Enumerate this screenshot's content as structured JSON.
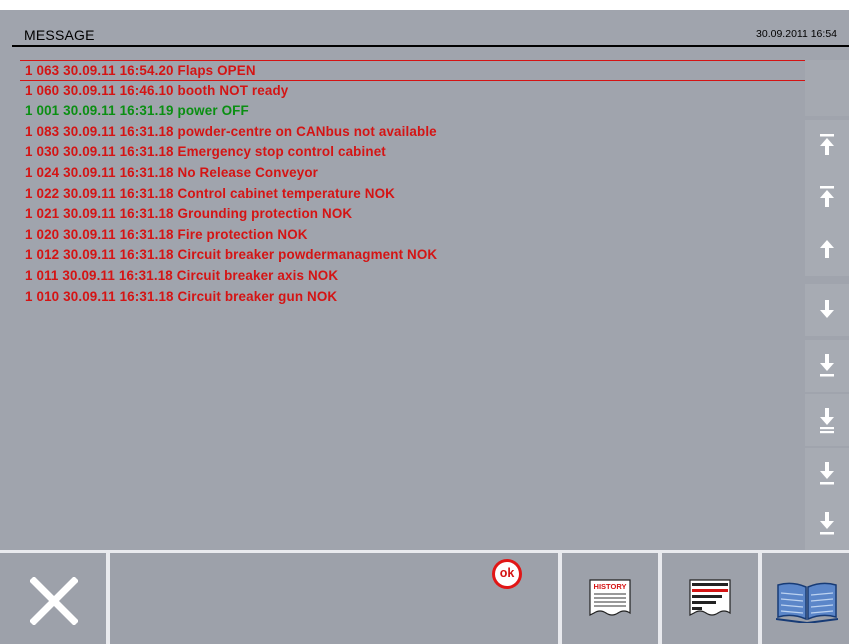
{
  "header": {
    "title": "MESSAGE",
    "datetime": "30.09.2011 16:54"
  },
  "messages": [
    {
      "text": "1  063  30.09.11  16:54.20 Flaps OPEN",
      "color": "red",
      "selected": true
    },
    {
      "text": "1  060  30.09.11  16:46.10 booth NOT ready",
      "color": "red",
      "selected": false
    },
    {
      "text": "1  001  30.09.11  16:31.19 power OFF",
      "color": "green",
      "selected": false
    },
    {
      "text": "1  083  30.09.11  16:31.18 powder-centre on CANbus not available",
      "color": "red",
      "selected": false
    },
    {
      "text": "1  030  30.09.11  16:31.18 Emergency stop control cabinet",
      "color": "red",
      "selected": false
    },
    {
      "text": "1  024  30.09.11  16:31.18 No Release Conveyor",
      "color": "red",
      "selected": false
    },
    {
      "text": "1  022  30.09.11  16:31.18 Control cabinet temperature NOK",
      "color": "red",
      "selected": false
    },
    {
      "text": "1  021  30.09.11  16:31.18 Grounding protection NOK",
      "color": "red",
      "selected": false
    },
    {
      "text": "1  020  30.09.11  16:31.18 Fire protection NOK",
      "color": "red",
      "selected": false
    },
    {
      "text": "1  012  30.09.11  16:31.18 Circuit breaker powdermanagment NOK",
      "color": "red",
      "selected": false
    },
    {
      "text": "1  011  30.09.11  16:31.18 Circuit breaker axis NOK",
      "color": "red",
      "selected": false
    },
    {
      "text": "1  010  30.09.11  16:31.18 Circuit breaker gun NOK",
      "color": "red",
      "selected": false
    }
  ],
  "scroll_buttons": [
    {
      "name": "scroll-top-button",
      "icon": "arrow-up-to-top-icon"
    },
    {
      "name": "page-up-button",
      "icon": "arrow-up-to-line-icon"
    },
    {
      "name": "line-up-button",
      "icon": "arrow-up-icon"
    },
    {
      "name": "line-down-button",
      "icon": "arrow-down-icon"
    },
    {
      "name": "page-down-button",
      "icon": "arrow-down-to-line-icon"
    },
    {
      "name": "scroll-down-2-button",
      "icon": "arrow-down-to-double-line-icon"
    },
    {
      "name": "scroll-down-3-button",
      "icon": "arrow-down-to-line-icon"
    },
    {
      "name": "scroll-bottom-button",
      "icon": "arrow-down-to-bottom-icon"
    }
  ],
  "footer": {
    "ok_label": "ok",
    "history_label": "HISTORY",
    "log_label": "LOG",
    "close_icon": "close-x-icon",
    "manual_icon": "open-book-icon"
  },
  "colors": {
    "background": "#a0a4ad",
    "alarm_red": "#d41414",
    "status_green": "#0a8f12",
    "divider": "#e9eaee"
  }
}
